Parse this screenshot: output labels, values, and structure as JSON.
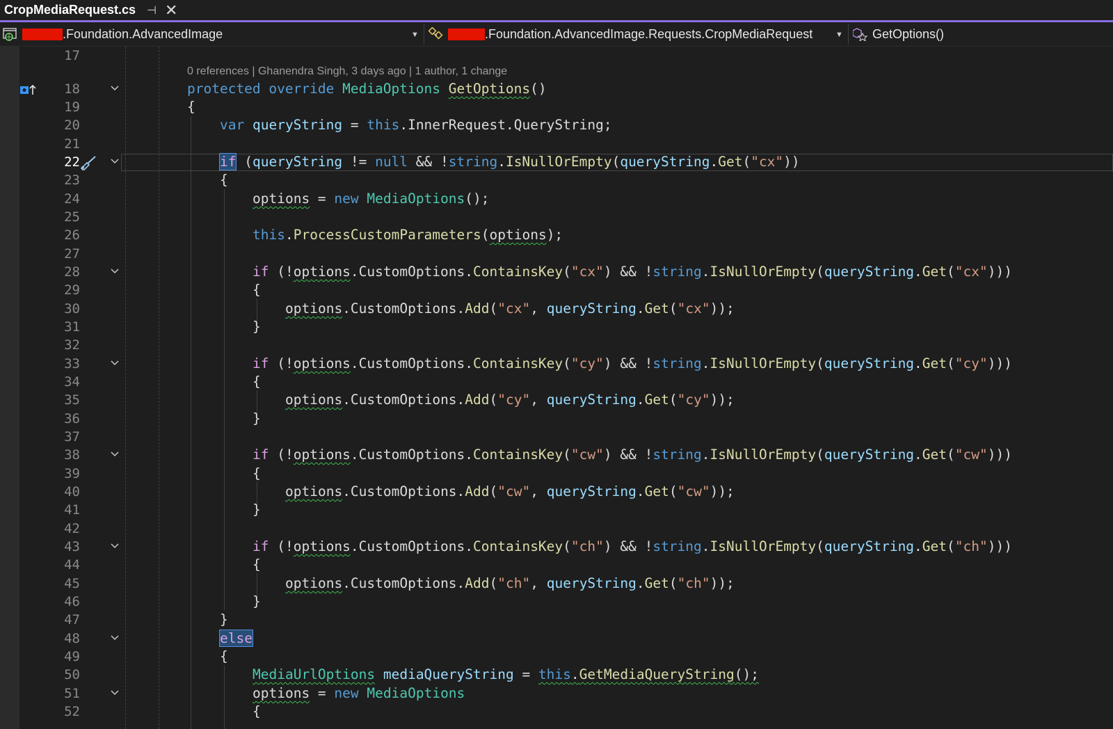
{
  "tab": {
    "title": "CropMediaRequest.cs",
    "pin_glyph": "⊣",
    "close_glyph": "✕"
  },
  "navbar": {
    "project_suffix": ".Foundation.AdvancedImage",
    "type_suffix": ".Foundation.AdvancedImage.Requests.CropMediaRequest",
    "member": "GetOptions()"
  },
  "codelens": {
    "text": "0 references | Ghanendra Singh, 3 days ago | 1 author, 1 change"
  },
  "colors": {
    "accent": "#8b6fe2",
    "keyword": "#569cd6",
    "control": "#d8a0df",
    "type": "#4ec9b0",
    "method": "#dcdcaa",
    "variable": "#9cdcfe",
    "string": "#d69d85",
    "redaction": "#e51400"
  },
  "editor": {
    "current_line": 22,
    "line_numbers": [
      "17",
      "18",
      "19",
      "20",
      "21",
      "22",
      "23",
      "24",
      "25",
      "26",
      "27",
      "28",
      "29",
      "30",
      "31",
      "32",
      "33",
      "34",
      "35",
      "36",
      "37",
      "38",
      "39",
      "40",
      "41",
      "42",
      "43",
      "44",
      "45",
      "46",
      "47",
      "48",
      "49",
      "50",
      "51",
      "52"
    ],
    "lines": {
      "l18": {
        "t1": "protected",
        "t2": "override",
        "t3": "MediaOptions",
        "t4": "GetOptions",
        "t5": "()"
      },
      "l19": {
        "t1": "{"
      },
      "l20": {
        "t1": "var",
        "t2": "queryString",
        "t3": " = ",
        "t4": "this",
        "t5": ".",
        "t6": "InnerRequest",
        "t7": ".",
        "t8": "QueryString",
        "t9": ";"
      },
      "l22": {
        "t1": "if",
        "t2": " (",
        "t3": "queryString",
        "t4": " != ",
        "t5": "null",
        "t6": " && !",
        "t7": "string",
        "t8": ".",
        "t9": "IsNullOrEmpty",
        "t10": "(",
        "t11": "queryString",
        "t12": ".",
        "t13": "Get",
        "t14": "(",
        "t15": "\"cx\"",
        "t16": "))"
      },
      "l23": {
        "t1": "{"
      },
      "l24": {
        "t1": "options",
        "t2": " = ",
        "t3": "new",
        "t4": " ",
        "t5": "MediaOptions",
        "t6": "();"
      },
      "l26": {
        "t1": "this",
        "t2": ".",
        "t3": "ProcessCustomParameters",
        "t4": "(",
        "t5": "options",
        "t6": ");"
      },
      "l28": {
        "t1": "if",
        "t2": " (!",
        "t3": "options",
        "t4": ".CustomOptions.",
        "t5": "ContainsKey",
        "t6": "(",
        "t7": "\"cx\"",
        "t8": ") && !",
        "t9": "string",
        "t10": ".",
        "t11": "IsNullOrEmpty",
        "t12": "(",
        "t13": "queryString",
        "t14": ".",
        "t15": "Get",
        "t16": "(",
        "t17": "\"cx\"",
        "t18": ")))"
      },
      "l29": {
        "t1": "{"
      },
      "l30": {
        "t1": "options",
        "t2": ".CustomOptions.",
        "t3": "Add",
        "t4": "(",
        "t5": "\"cx\"",
        "t6": ", ",
        "t7": "queryString",
        "t8": ".",
        "t9": "Get",
        "t10": "(",
        "t11": "\"cx\"",
        "t12": "));"
      },
      "l31": {
        "t1": "}"
      },
      "l33": {
        "t1": "if",
        "t2": " (!",
        "t3": "options",
        "t4": ".CustomOptions.",
        "t5": "ContainsKey",
        "t6": "(",
        "t7": "\"cy\"",
        "t8": ") && !",
        "t9": "string",
        "t10": ".",
        "t11": "IsNullOrEmpty",
        "t12": "(",
        "t13": "queryString",
        "t14": ".",
        "t15": "Get",
        "t16": "(",
        "t17": "\"cy\"",
        "t18": ")))"
      },
      "l34": {
        "t1": "{"
      },
      "l35": {
        "t1": "options",
        "t2": ".CustomOptions.",
        "t3": "Add",
        "t4": "(",
        "t5": "\"cy\"",
        "t6": ", ",
        "t7": "queryString",
        "t8": ".",
        "t9": "Get",
        "t10": "(",
        "t11": "\"cy\"",
        "t12": "));"
      },
      "l36": {
        "t1": "}"
      },
      "l38": {
        "t1": "if",
        "t2": " (!",
        "t3": "options",
        "t4": ".CustomOptions.",
        "t5": "ContainsKey",
        "t6": "(",
        "t7": "\"cw\"",
        "t8": ") && !",
        "t9": "string",
        "t10": ".",
        "t11": "IsNullOrEmpty",
        "t12": "(",
        "t13": "queryString",
        "t14": ".",
        "t15": "Get",
        "t16": "(",
        "t17": "\"cw\"",
        "t18": ")))"
      },
      "l39": {
        "t1": "{"
      },
      "l40": {
        "t1": "options",
        "t2": ".CustomOptions.",
        "t3": "Add",
        "t4": "(",
        "t5": "\"cw\"",
        "t6": ", ",
        "t7": "queryString",
        "t8": ".",
        "t9": "Get",
        "t10": "(",
        "t11": "\"cw\"",
        "t12": "));"
      },
      "l41": {
        "t1": "}"
      },
      "l43": {
        "t1": "if",
        "t2": " (!",
        "t3": "options",
        "t4": ".CustomOptions.",
        "t5": "ContainsKey",
        "t6": "(",
        "t7": "\"ch\"",
        "t8": ") && !",
        "t9": "string",
        "t10": ".",
        "t11": "IsNullOrEmpty",
        "t12": "(",
        "t13": "queryString",
        "t14": ".",
        "t15": "Get",
        "t16": "(",
        "t17": "\"ch\"",
        "t18": ")))"
      },
      "l44": {
        "t1": "{"
      },
      "l45": {
        "t1": "options",
        "t2": ".CustomOptions.",
        "t3": "Add",
        "t4": "(",
        "t5": "\"ch\"",
        "t6": ", ",
        "t7": "queryString",
        "t8": ".",
        "t9": "Get",
        "t10": "(",
        "t11": "\"ch\"",
        "t12": "));"
      },
      "l46": {
        "t1": "}"
      },
      "l47": {
        "t1": "}"
      },
      "l48": {
        "t1": "else"
      },
      "l49": {
        "t1": "{"
      },
      "l50": {
        "t1": "MediaUrlOptions",
        "t2": " ",
        "t3": "mediaQueryString",
        "t4": " = ",
        "t5": "this",
        "t6": ".",
        "t7": "GetMediaQueryString",
        "t8": "();"
      },
      "l51": {
        "t1": "options",
        "t2": " = ",
        "t3": "new",
        "t4": " ",
        "t5": "MediaOptions"
      },
      "l52": {
        "t1": "{"
      }
    }
  }
}
